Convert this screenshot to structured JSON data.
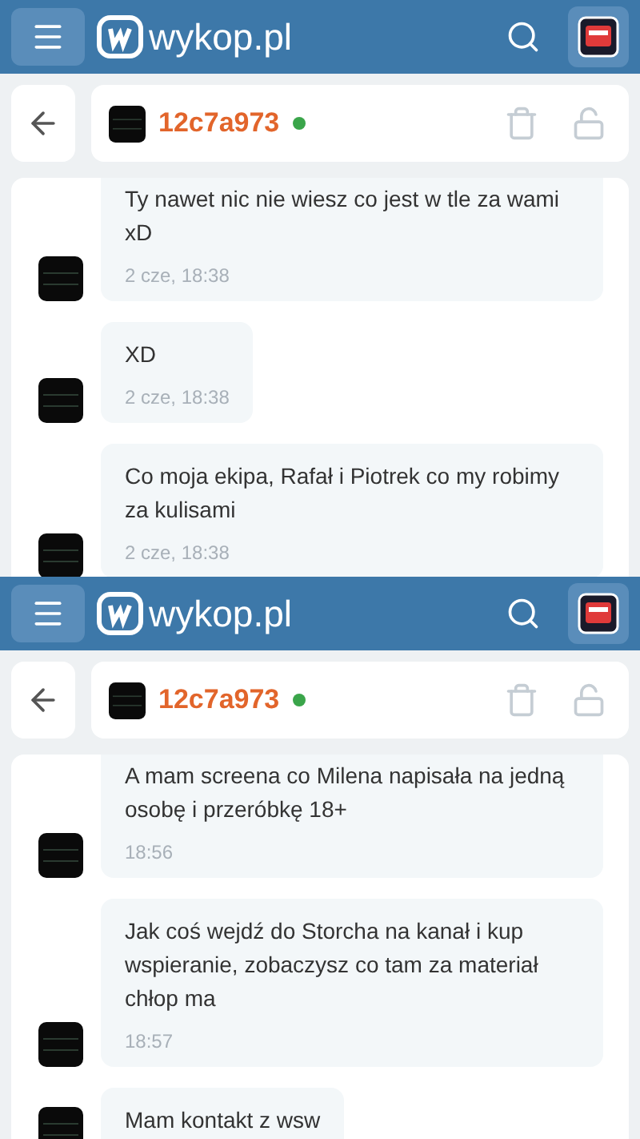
{
  "screenshots": [
    {
      "logo_text": "wykop.pl",
      "username": "12c7a973",
      "online": true,
      "messages": [
        {
          "text": "Ty nawet nic nie wiesz co jest w tle za wami xD",
          "time": "2 cze, 18:38"
        },
        {
          "text": "XD",
          "time": "2 cze, 18:38"
        },
        {
          "text": "Co moja ekipa, Rafał i Piotrek co my robimy za kulisami",
          "time": "2 cze, 18:38"
        }
      ]
    },
    {
      "logo_text": "wykop.pl",
      "username": "12c7a973",
      "online": true,
      "messages": [
        {
          "text": "A mam screena co Milena napisała na jedną osobę i przeróbkę 18+",
          "time": "18:56"
        },
        {
          "text": "Jak coś wejdź do Storcha na kanał i kup wspieranie, zobaczysz co tam za materiał chłop ma",
          "time": "18:57"
        },
        {
          "text": "Mam kontakt z wsw"
        }
      ]
    }
  ]
}
